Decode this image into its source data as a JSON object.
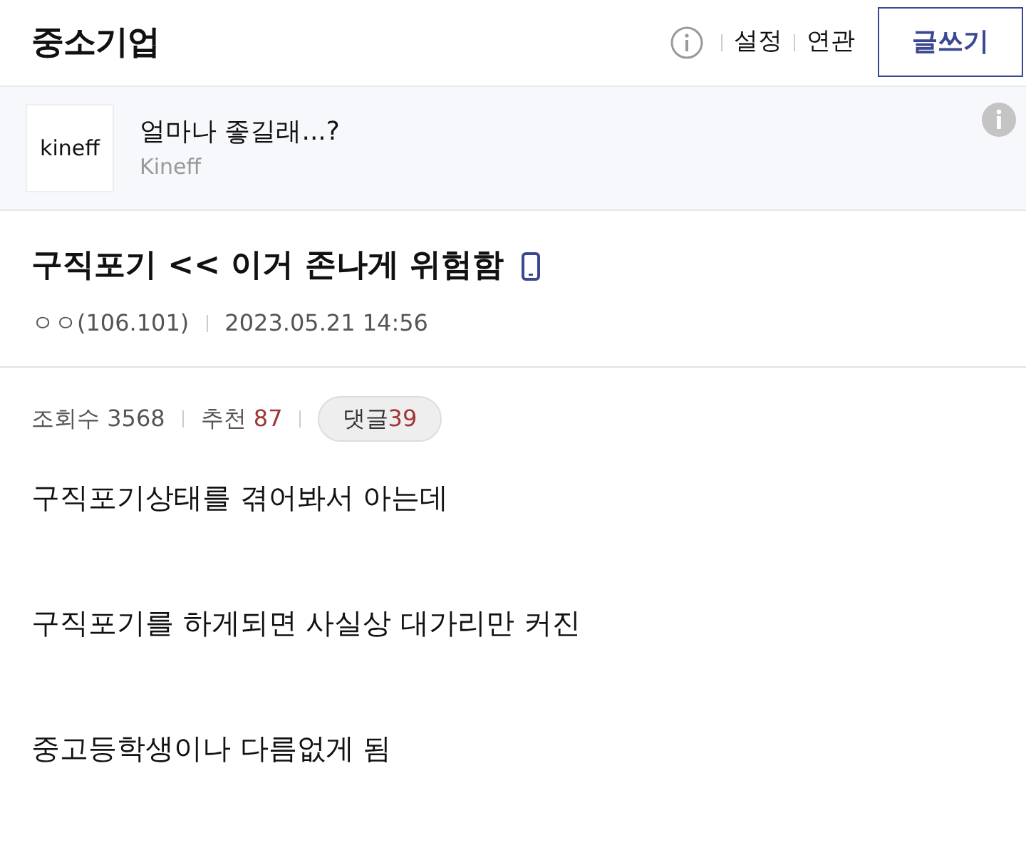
{
  "header": {
    "title": "중소기업",
    "links": [
      "설정",
      "연관"
    ],
    "write_button": "글쓰기"
  },
  "ad": {
    "logo": "kineff",
    "headline": "얼마나 좋길래...?",
    "advertiser": "Kineff"
  },
  "post": {
    "title": "구직포기 << 이거 존나게 위험함",
    "author": "ㅇㅇ(106.101)",
    "date": "2023.05.21 14:56",
    "stats": {
      "views_label": "조회수",
      "views": "3568",
      "likes_label": "추천",
      "likes": "87",
      "comments_label": "댓글",
      "comments": "39"
    },
    "body": [
      "구직포기상태를 겪어봐서 아는데",
      "구직포기를 하게되면 사실상 대가리만 커진",
      "중고등학생이나 다름없게 됨"
    ]
  }
}
